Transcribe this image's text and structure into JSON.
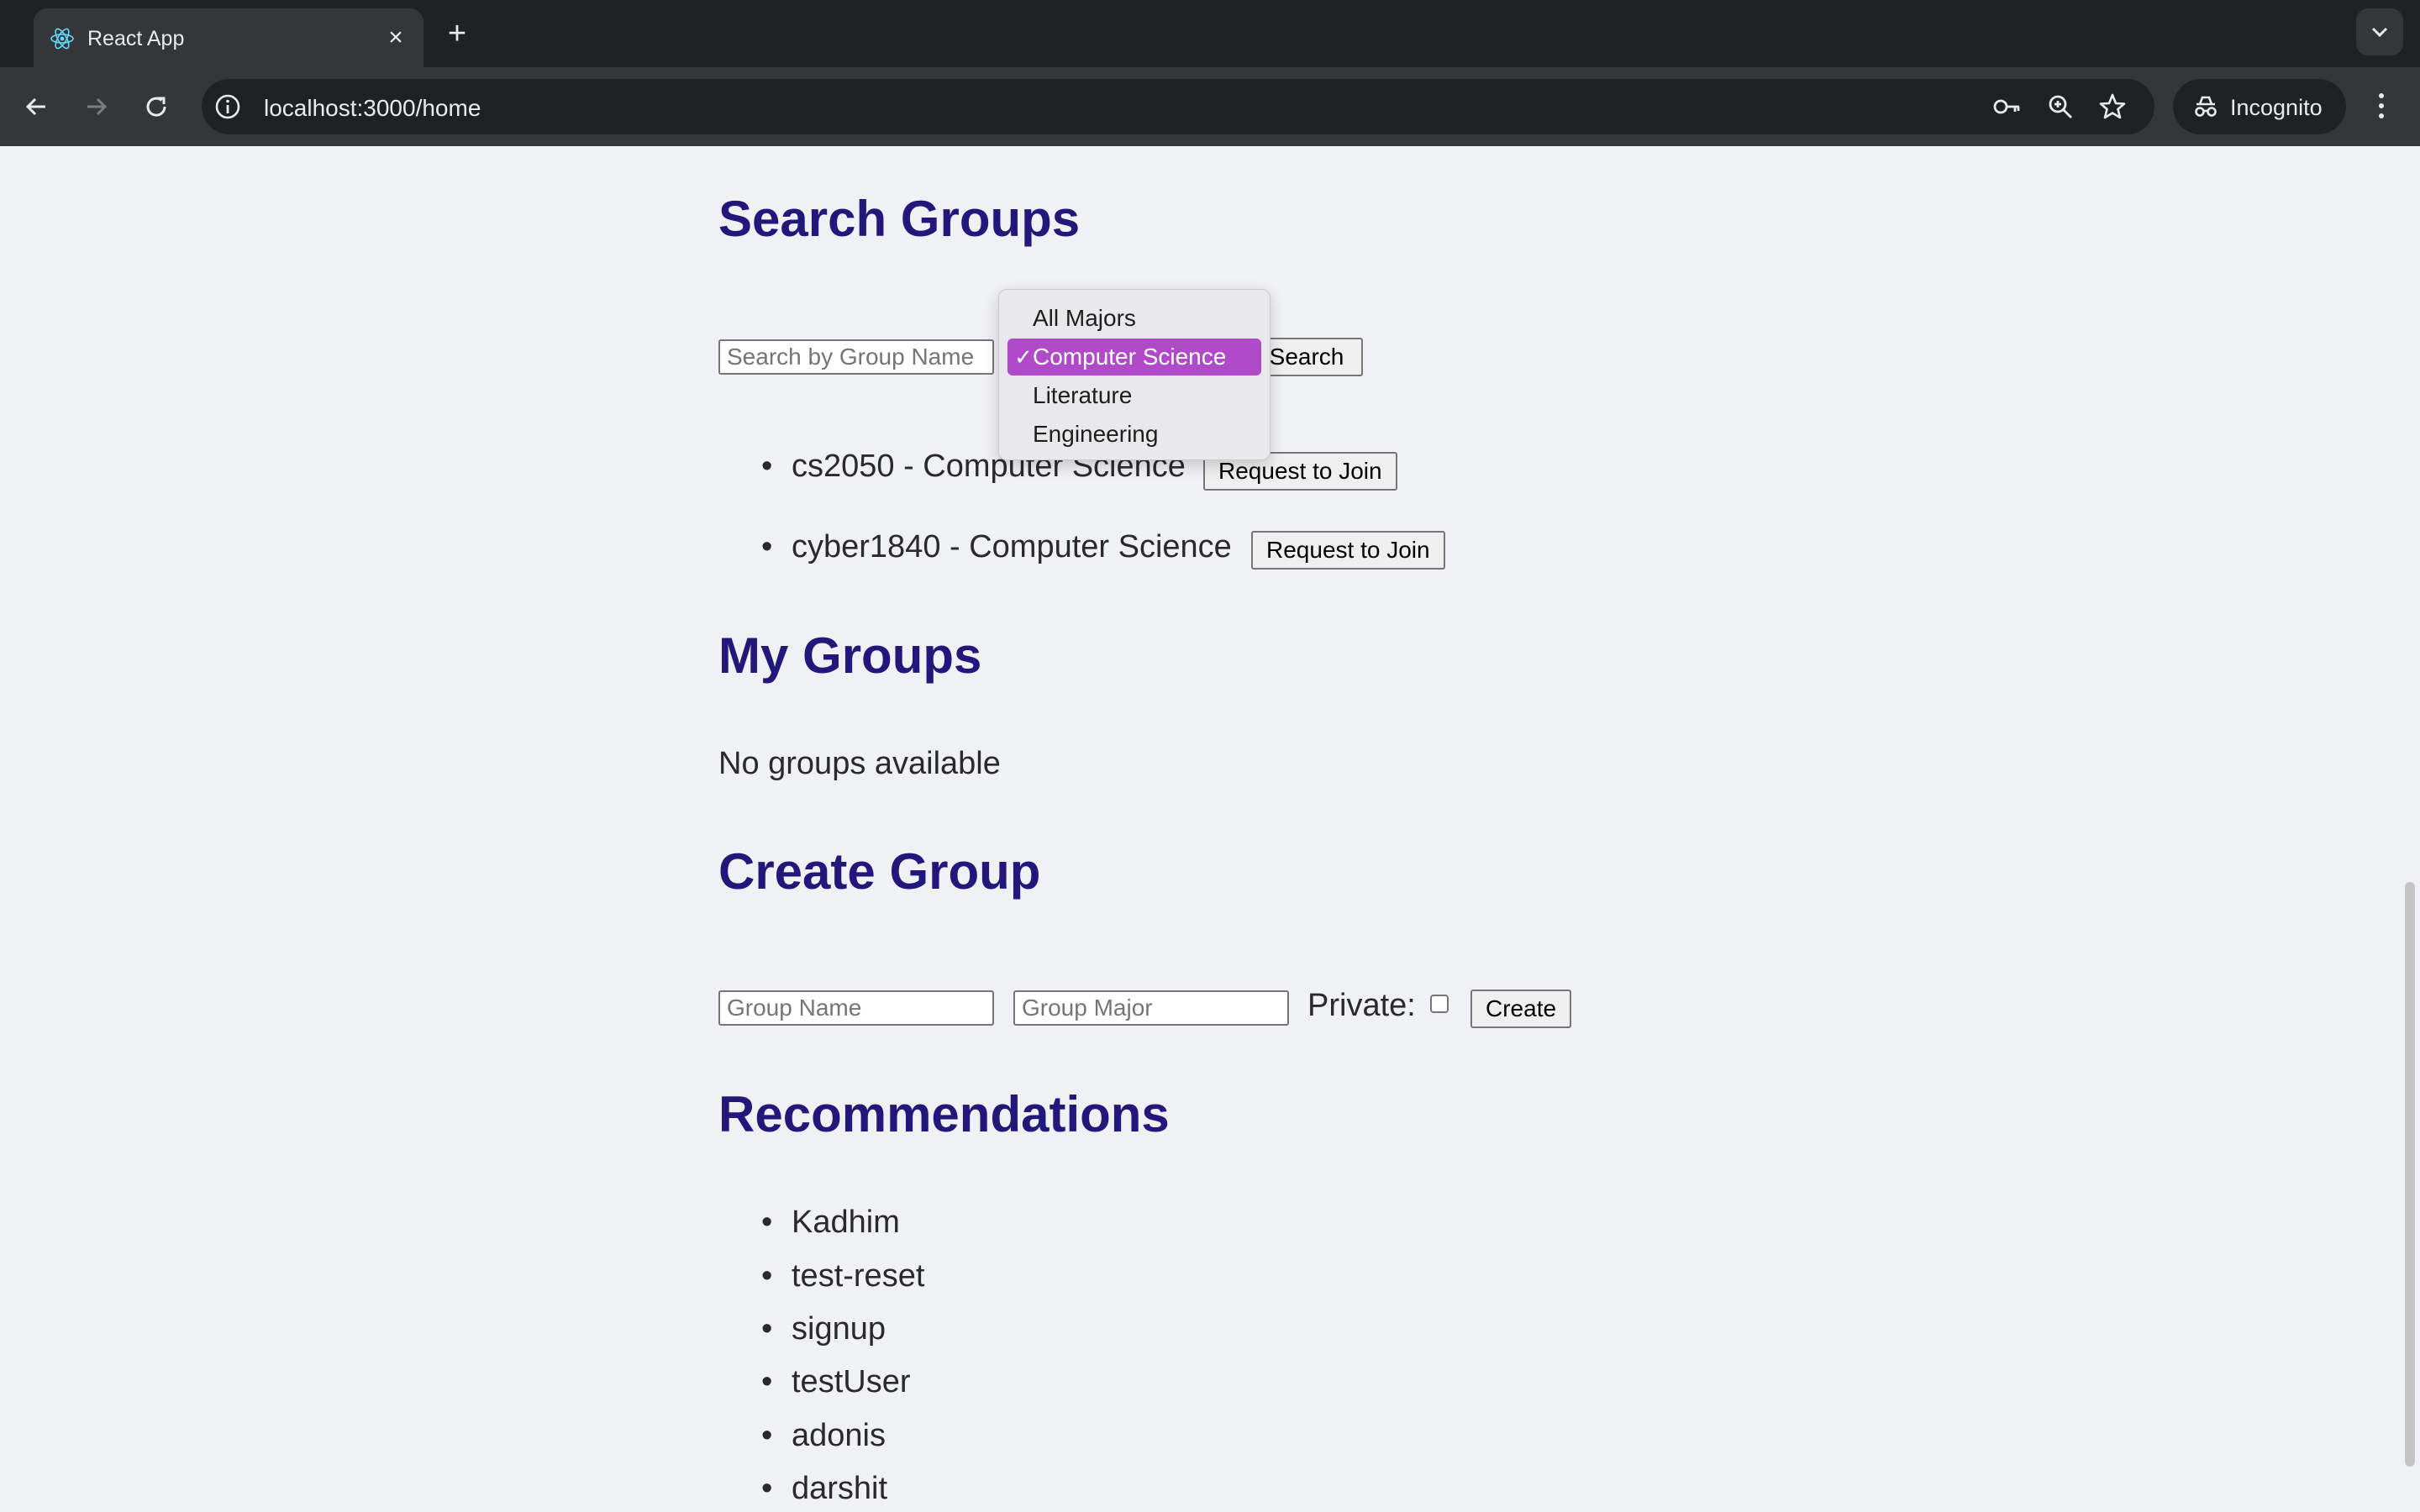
{
  "browser": {
    "tab_title": "React App",
    "url": "localhost:3000/home",
    "incognito_label": "Incognito",
    "icons": {
      "favicon": "react-logo-icon",
      "close": "close-icon",
      "new_tab": "plus-icon",
      "back": "arrow-left-icon",
      "forward": "arrow-right-icon",
      "reload": "reload-icon",
      "info": "info-icon",
      "password": "key-icon",
      "zoom": "zoom-icon",
      "bookmark": "star-icon",
      "menu": "kebab-menu-icon"
    }
  },
  "search_section": {
    "title": "Search Groups",
    "search_placeholder": "Search by Group Name",
    "search_button": "Search",
    "major_options": [
      "All Majors",
      "Computer Science",
      "Literature",
      "Engineering"
    ],
    "selected_major": "Computer Science",
    "check_glyph": "✓",
    "results": [
      {
        "text": "cs2050 - Computer Science",
        "button": "Request to Join"
      },
      {
        "text": "cyber1840 - Computer Science",
        "button": "Request to Join"
      }
    ]
  },
  "my_groups": {
    "title": "My Groups",
    "empty_text": "No groups available"
  },
  "create_group": {
    "title": "Create Group",
    "name_placeholder": "Group Name",
    "major_placeholder": "Group Major",
    "private_label": "Private:",
    "private_checked": false,
    "create_button": "Create"
  },
  "recommendations": {
    "title": "Recommendations",
    "items": [
      "Kadhim",
      "test-reset",
      "signup",
      "testUser",
      "adonis",
      "darshit"
    ]
  },
  "colors": {
    "heading": "#22177a",
    "dropdown_selected": "#b14ac8"
  }
}
